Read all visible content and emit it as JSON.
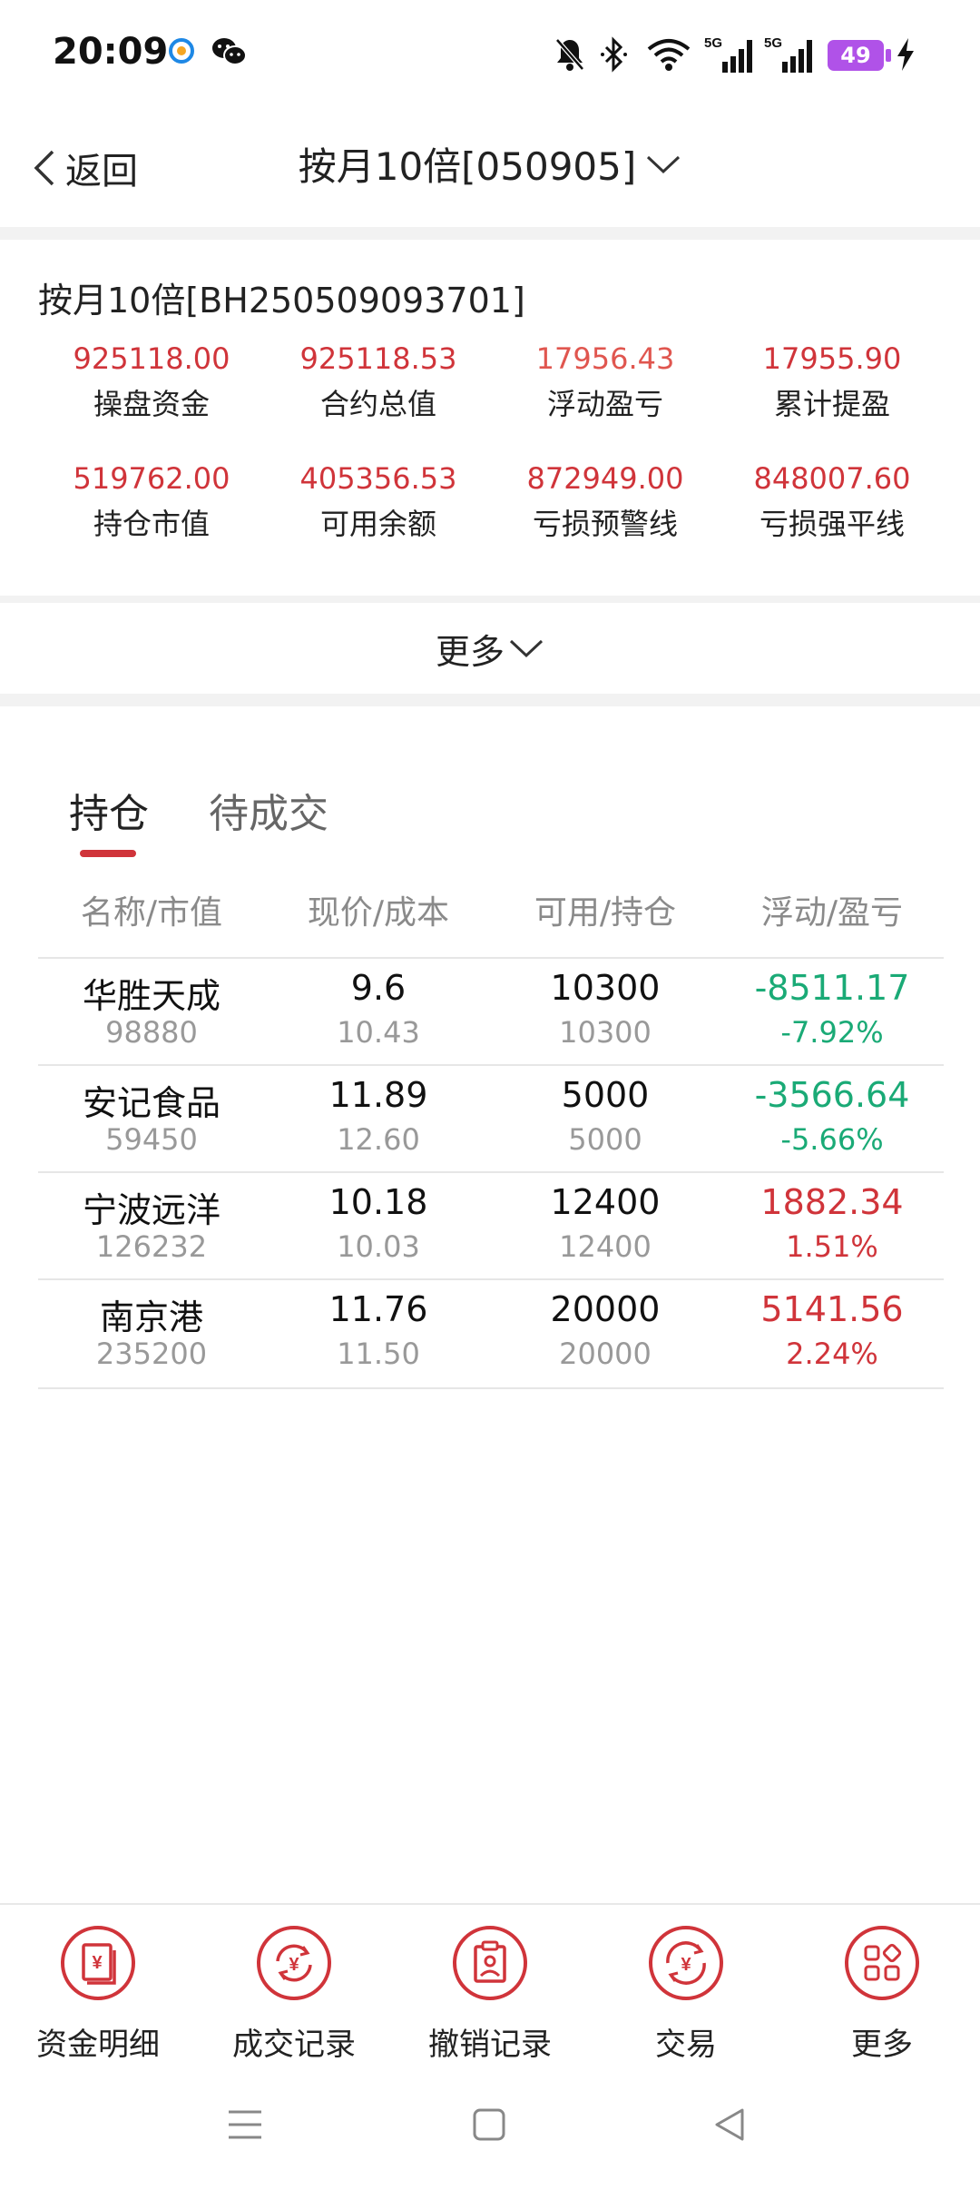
{
  "status_bar": {
    "time": "20:09",
    "battery": "49"
  },
  "header": {
    "back_label": "返回",
    "title": "按月10倍[050905]"
  },
  "account": {
    "title": "按月10倍[BH250509093701]",
    "stats": [
      {
        "value": "925118.00",
        "label": "操盘资金"
      },
      {
        "value": "925118.53",
        "label": "合约总值"
      },
      {
        "value": "17956.43",
        "label": "浮动盈亏"
      },
      {
        "value": "17955.90",
        "label": "累计提盈"
      },
      {
        "value": "519762.00",
        "label": "持仓市值"
      },
      {
        "value": "405356.53",
        "label": "可用余额"
      },
      {
        "value": "872949.00",
        "label": "亏损预警线"
      },
      {
        "value": "848007.60",
        "label": "亏损强平线"
      }
    ],
    "more_label": "更多"
  },
  "tabs": [
    {
      "label": "持仓"
    },
    {
      "label": "待成交"
    }
  ],
  "table": {
    "headers": [
      "名称/市值",
      "现价/成本",
      "可用/持仓",
      "浮动/盈亏"
    ],
    "rows": [
      {
        "name": "华胜天成",
        "value": "98880",
        "price": "9.6",
        "cost": "10.43",
        "avail": "10300",
        "hold": "10300",
        "pl": "-8511.17",
        "pct": "-7.92%",
        "dir": "down"
      },
      {
        "name": "安记食品",
        "value": "59450",
        "price": "11.89",
        "cost": "12.60",
        "avail": "5000",
        "hold": "5000",
        "pl": "-3566.64",
        "pct": "-5.66%",
        "dir": "down"
      },
      {
        "name": "宁波远洋",
        "value": "126232",
        "price": "10.18",
        "cost": "10.03",
        "avail": "12400",
        "hold": "12400",
        "pl": "1882.34",
        "pct": "1.51%",
        "dir": "up"
      },
      {
        "name": "南京港",
        "value": "235200",
        "price": "11.76",
        "cost": "11.50",
        "avail": "20000",
        "hold": "20000",
        "pl": "5141.56",
        "pct": "2.24%",
        "dir": "up"
      }
    ]
  },
  "toolbar": [
    {
      "label": "资金明细",
      "icon": "fund-detail-icon"
    },
    {
      "label": "成交记录",
      "icon": "deal-record-icon"
    },
    {
      "label": "撤销记录",
      "icon": "cancel-record-icon"
    },
    {
      "label": "交易",
      "icon": "trade-icon"
    },
    {
      "label": "更多",
      "icon": "more-grid-icon"
    }
  ],
  "colors": {
    "accent": "#d0343a",
    "down": "#1aaa76",
    "muted": "#999999"
  }
}
